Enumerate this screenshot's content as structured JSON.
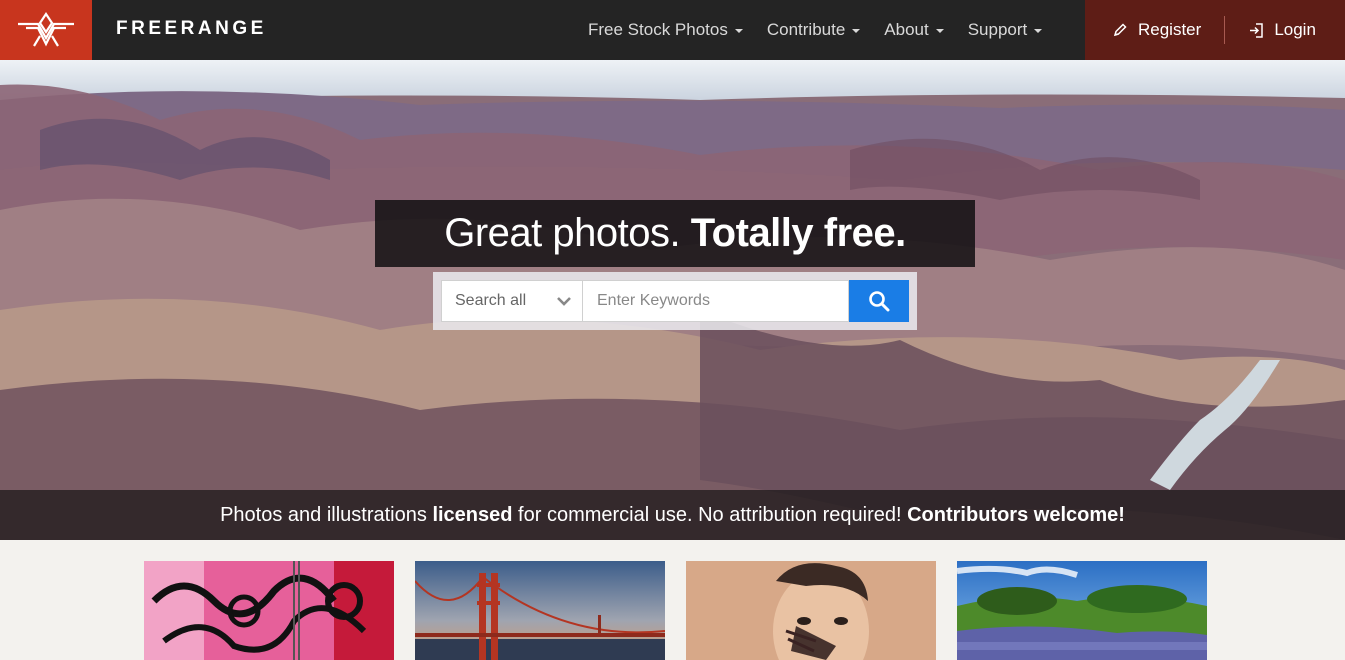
{
  "brand": {
    "name": "FREERANGE",
    "logo_icon": "freerange-logo-icon",
    "logo_color": "#c8351e"
  },
  "nav": {
    "items": [
      {
        "label": "Free Stock Photos"
      },
      {
        "label": "Contribute"
      },
      {
        "label": "About"
      },
      {
        "label": "Support"
      }
    ]
  },
  "account": {
    "register_label": "Register",
    "register_icon": "pencil-icon",
    "login_label": "Login",
    "login_icon": "login-arrow-icon",
    "bg_color": "#5e1d16"
  },
  "hero": {
    "headline_regular": "Great photos.",
    "headline_bold": "Totally free.",
    "search_scope": "Search all",
    "search_placeholder": "Enter Keywords",
    "search_button_icon": "search-icon",
    "search_button_color": "#1a7de6",
    "tagline_part1": "Photos and illustrations",
    "tagline_bold1": "licensed",
    "tagline_part2": "for commercial use. No attribution required!",
    "tagline_bold2": "Contributors welcome!"
  },
  "thumbnails": [
    {
      "subject": "graffiti"
    },
    {
      "subject": "golden-gate-bridge"
    },
    {
      "subject": "painted-hand-face"
    },
    {
      "subject": "bluebonnet-field"
    }
  ]
}
